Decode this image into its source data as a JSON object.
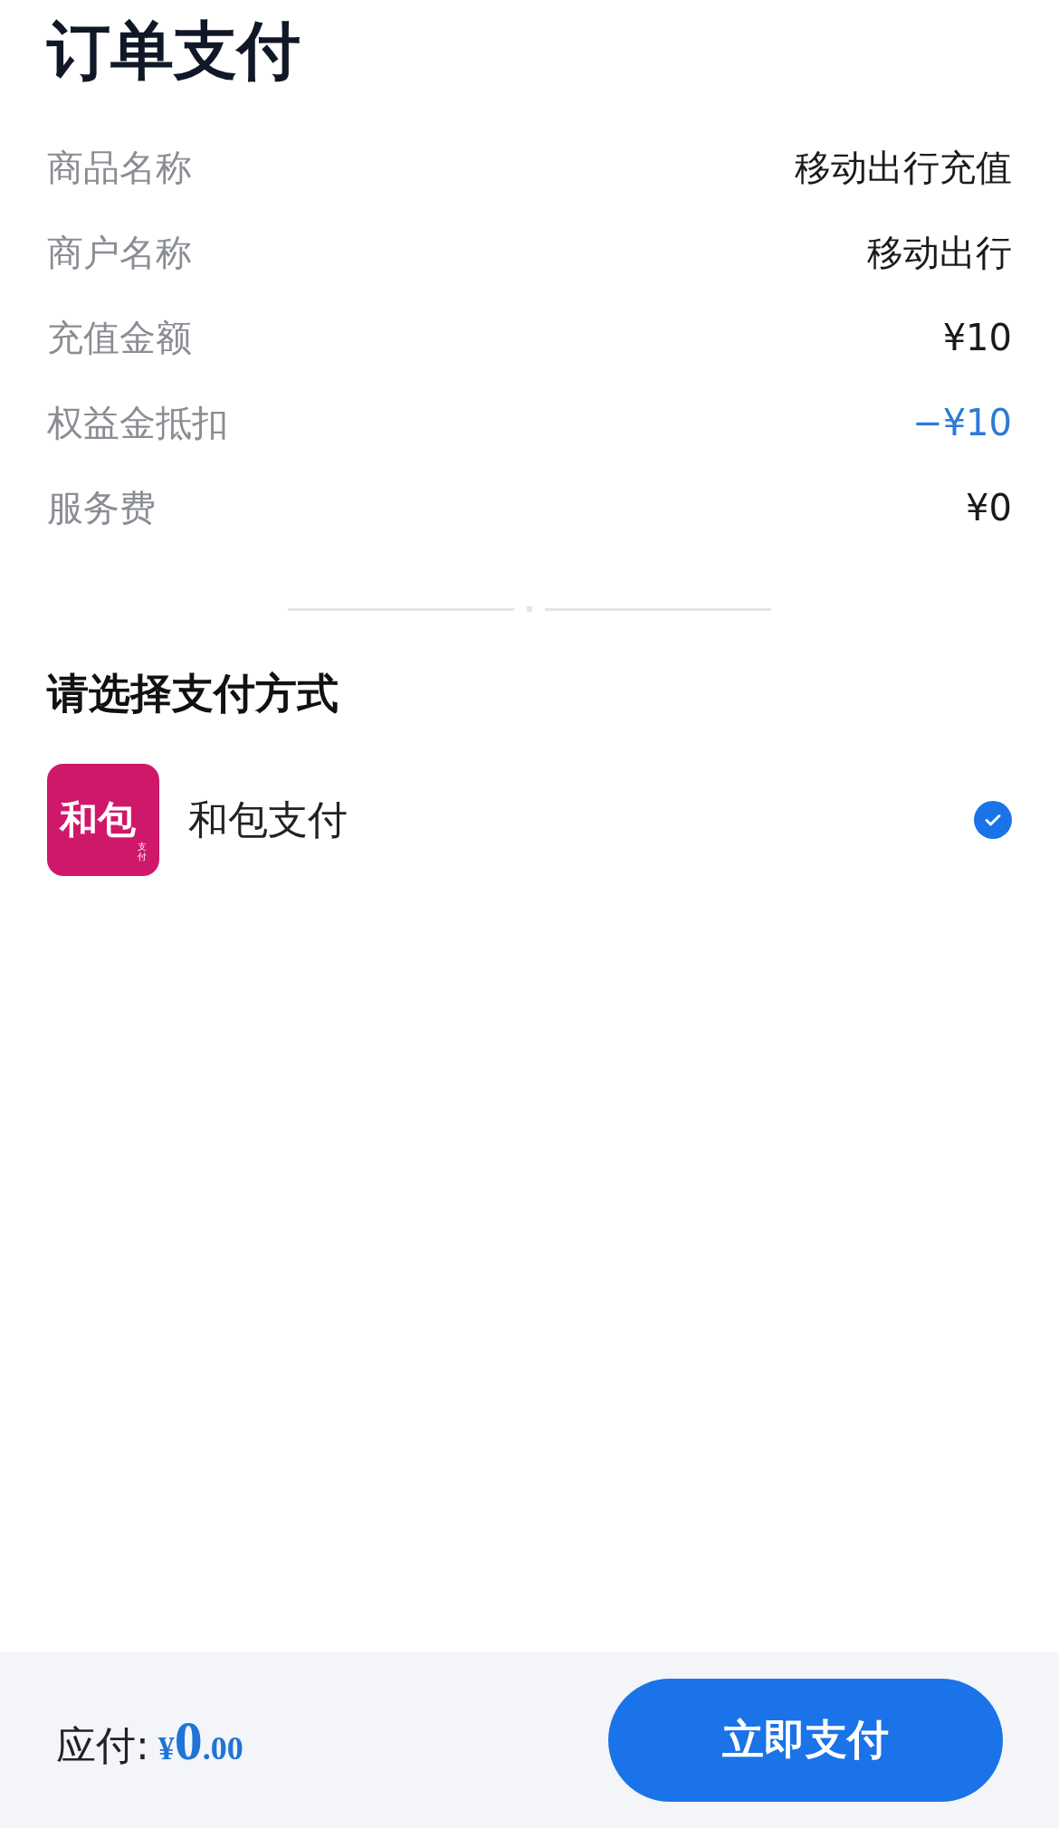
{
  "title": "订单支付",
  "details": [
    {
      "label": "商品名称",
      "value": "移动出行充值",
      "kind": "plain"
    },
    {
      "label": "商户名称",
      "value": "移动出行",
      "kind": "plain"
    },
    {
      "label": "充值金额",
      "value": "¥10",
      "kind": "plain"
    },
    {
      "label": "权益金抵扣",
      "value": "−¥10",
      "kind": "discount"
    },
    {
      "label": "服务费",
      "value": "¥0",
      "kind": "plain"
    }
  ],
  "payment_section": {
    "heading": "请选择支付方式",
    "methods": [
      {
        "name": "和包支付",
        "logo_text": "和包",
        "logo_subtext": "支付",
        "selected": true
      }
    ]
  },
  "footer": {
    "label": "应付:",
    "currency": "¥",
    "integer": "0",
    "decimal": ".00",
    "button": "立即支付"
  }
}
